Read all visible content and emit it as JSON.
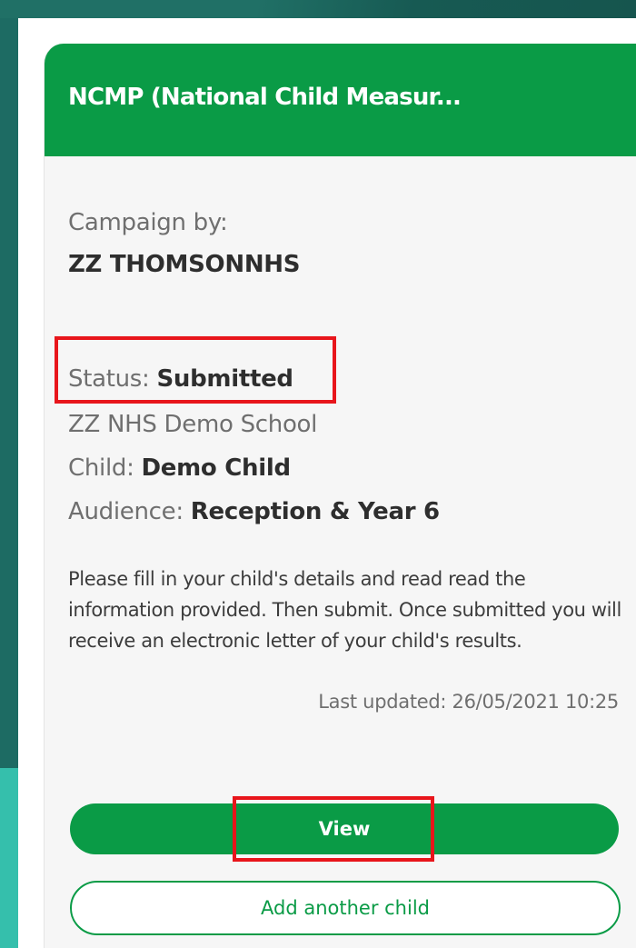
{
  "card": {
    "title": "NCMP (National Child Measur...",
    "campaign_by_label": "Campaign by:",
    "campaign_by_value": "ZZ THOMSONNHS",
    "status_label": "Status: ",
    "status_value": "Submitted",
    "school": "ZZ NHS Demo School",
    "child_label": "Child: ",
    "child_value": "Demo Child",
    "audience_label": "Audience: ",
    "audience_value": "Reception & Year 6",
    "description": "Please fill in your child's details and read read the information provided. Then submit. Once submitted you will receive an electronic letter of your child's results.",
    "last_updated": "Last updated: 26/05/2021 10:25"
  },
  "actions": {
    "view_label": "View",
    "add_child_label": "Add another child"
  },
  "colors": {
    "brand_green": "#0a9b46",
    "highlight_red": "#e8151b",
    "background_teal": "#1d6b63"
  }
}
